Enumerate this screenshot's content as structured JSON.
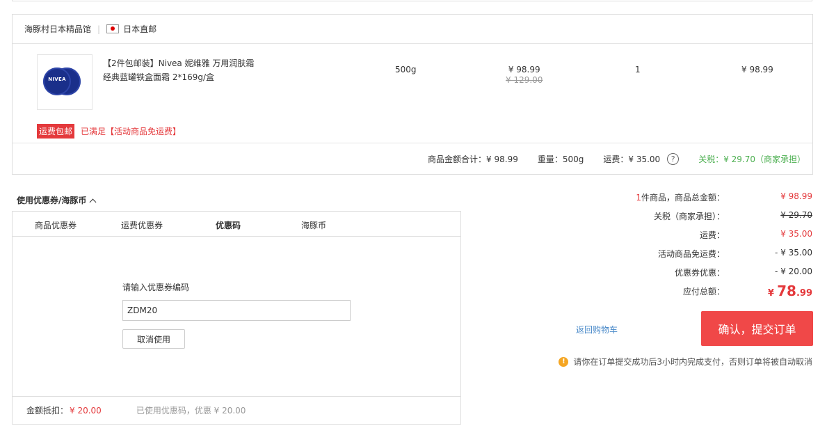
{
  "store": {
    "name": "海豚村日本精品馆",
    "separator": "|",
    "shipping_type": "日本直邮"
  },
  "product": {
    "title": "【2件包邮装】Nivea 妮维雅 万用润肤霜 经典蓝罐铁盒面霜 2*169g/盒",
    "image_brand_text": "NIVEA",
    "weight": "500g",
    "price": "¥ 98.99",
    "original_price": "¥ 129.00",
    "quantity": "1",
    "subtotal": "¥ 98.99",
    "shipping_badge": "运费包邮",
    "shipping_note": "已满足【活动商品免运费】"
  },
  "order_summary": {
    "goods_total": "商品金额合计：¥ 98.99",
    "weight": "重量：500g",
    "shipping": "运费：¥ 35.00",
    "help": "?",
    "tax": "关税：¥ 29.70（商家承担）"
  },
  "coupon": {
    "header": "使用优惠券/海豚币",
    "tabs": [
      "商品优惠券",
      "运费优惠券",
      "优惠码",
      "海豚币"
    ],
    "active_tab": "优惠码",
    "input_label": "请输入优惠券编码",
    "input_value": "ZDM20",
    "cancel_button": "取消使用",
    "deduct_label": "金额抵扣：",
    "deduct_value": "¥ 20.00",
    "used_note": "已使用优惠码，优惠 ¥ 20.00"
  },
  "totals": {
    "items_count": "1",
    "items_label": "件商品，商品总金额：",
    "items_value": "¥ 98.99",
    "tax_label": "关税（商家承担）：",
    "tax_value": "¥ 29.70",
    "shipping_label": "运费：",
    "shipping_value": "¥ 35.00",
    "free_ship_label": "活动商品免运费：",
    "free_ship_value": "- ¥ 35.00",
    "coupon_label": "优惠券优惠：",
    "coupon_value": "- ¥ 20.00",
    "grand_label": "应付总额：",
    "grand_symbol": "¥",
    "grand_int": "78",
    "grand_dec": ".99"
  },
  "actions": {
    "back_to_cart": "返回购物车",
    "submit": "确认，提交订单",
    "warning_icon": "!",
    "warning": "请你在订单提交成功后3小时内完成支付，否则订单将被自动取消"
  },
  "colors": {
    "accent_red": "#e4393c",
    "submit_bg": "#f04848",
    "tax_green": "#4caf50",
    "link_blue": "#4a8ac9"
  }
}
